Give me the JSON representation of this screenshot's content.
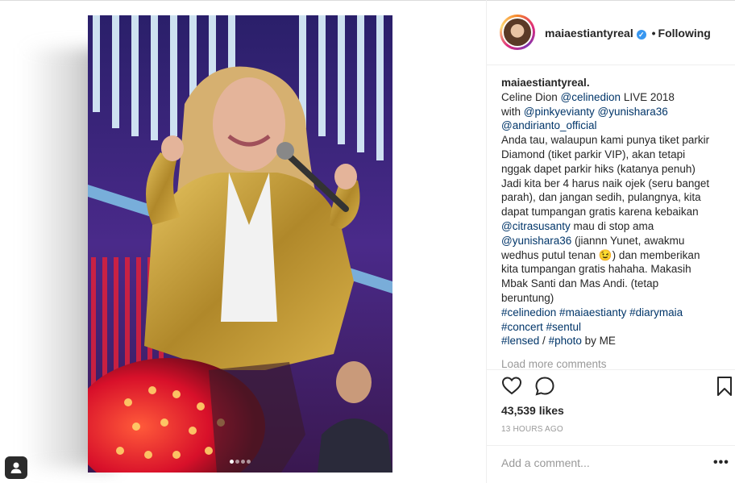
{
  "post": {
    "username": "maiaestiantyreal",
    "verified": true,
    "follow_separator": "•",
    "follow_status": "Following",
    "caption_username": "maiaestiantyreal",
    "caption_username_suffix": ".",
    "caption": {
      "l1_text": "Celine Dion ",
      "l1_mention": "@celinedion",
      "l1_rest": " LIVE 2018",
      "l2_text": "with ",
      "l2_mention1": "@pinkyevianty",
      "l2_mention2": "@yunishara36",
      "l3_mention": "@andirianto_official",
      "body1": "Anda tau, walaupun kami punya tiket parkir Diamond (tiket parkir VIP), akan tetapi nggak dapet parkir hiks (katanya penuh) Jadi kita ber 4 harus naik ojek (seru banget parah), dan jangan sedih, pulangnya, kita dapat tumpangan gratis karena kebaikan ",
      "mention4": "@citrasusanty",
      "body2": " mau di stop ama ",
      "mention5": "@yunishara36",
      "body3": " (jiannn Yunet, awakmu wedhus putul tenan 😉) dan memberikan kita tumpangan gratis hahaha. Makasih Mbak Santi dan Mas Andi. (tetap beruntung)",
      "hashtags1": "#celinedion #maiaestianty #diarymaia",
      "hashtags2": "#concert #sentul",
      "hashtag_lensed": "#lensed",
      "slash": " / ",
      "hashtag_photo": "#photo",
      "by_me": " by ME"
    },
    "load_more": "Load more comments",
    "likes": "43,539 likes",
    "timestamp": "13 HOURS AGO",
    "comment_placeholder": "Add a comment...",
    "more_options": "•••"
  },
  "carousel": {
    "count": 4,
    "active_index": 0
  },
  "icons": {
    "like": "heart-icon",
    "comment": "comment-icon",
    "save": "bookmark-icon",
    "verified": "verified-badge-icon",
    "badge": "user-tag-icon"
  },
  "colors": {
    "link": "#003569",
    "verified": "#3897f0",
    "muted": "#999999",
    "text": "#262626"
  }
}
